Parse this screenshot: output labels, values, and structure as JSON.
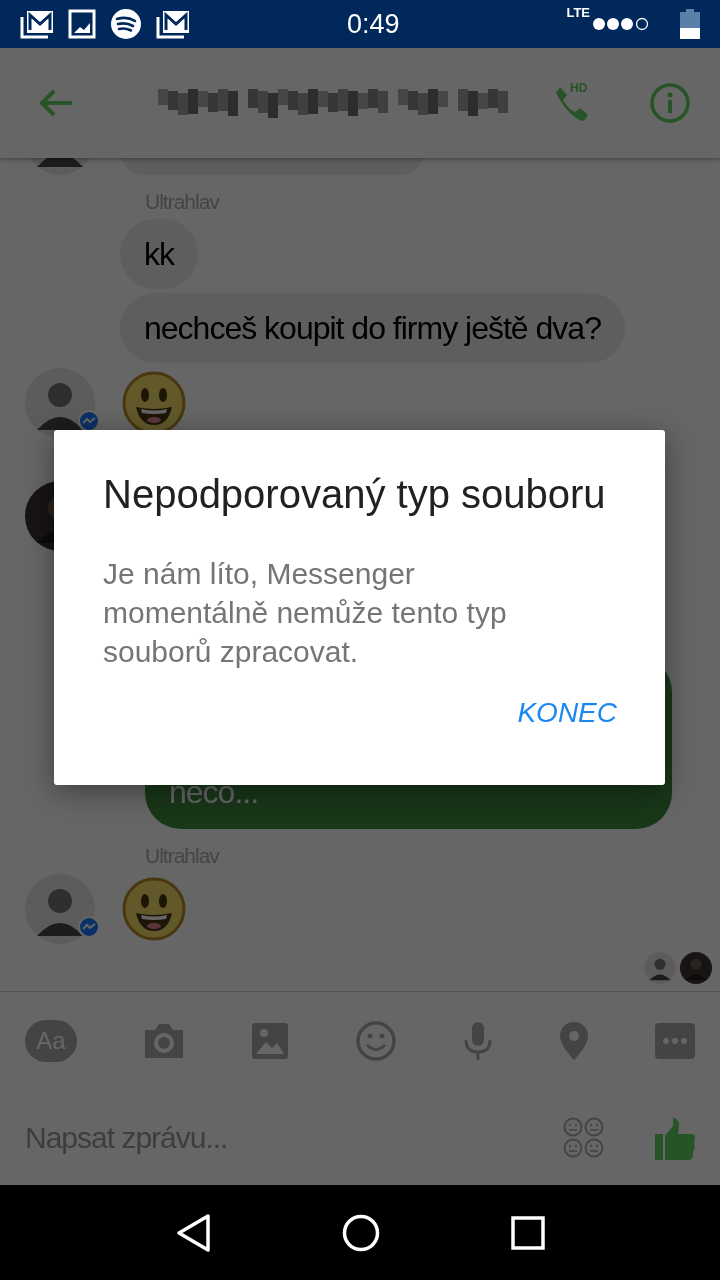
{
  "status_bar": {
    "time": "0:49",
    "network": "LTE"
  },
  "header": {
    "call_badge": "HD"
  },
  "chat": [
    {
      "kind": "partial"
    },
    {
      "kind": "sender",
      "text": "Ultrahlav"
    },
    {
      "kind": "text",
      "text": "kk"
    },
    {
      "kind": "text",
      "text": "nechceš koupit do firmy ještě dva?"
    },
    {
      "kind": "emoji"
    },
    {
      "kind": "avatar"
    },
    {
      "kind": "outgoing",
      "text": "neco..."
    },
    {
      "kind": "sender",
      "text": "Ultrahlav"
    },
    {
      "kind": "emoji"
    },
    {
      "kind": "seen"
    }
  ],
  "toolbar": {
    "text_button": "Aa"
  },
  "composer": {
    "placeholder": "Napsat zprávu..."
  },
  "dialog": {
    "title": "Nepodporovaný typ souboru",
    "message": "Je nám líto, Messenger momentálně nemůže tento typ souborů zpracovat.",
    "button": "KONEC"
  }
}
